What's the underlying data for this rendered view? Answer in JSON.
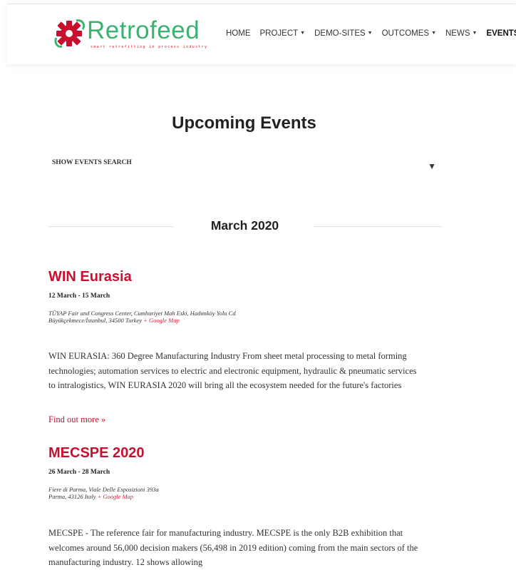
{
  "brand": {
    "name": "Retrofeed",
    "tagline": "smart retrofitting in process industry",
    "logo_color": "#3bb26f",
    "accent": "#c8102e"
  },
  "nav": [
    {
      "label": "HOME",
      "dropdown": false,
      "active": false
    },
    {
      "label": "PROJECT",
      "dropdown": true,
      "active": false
    },
    {
      "label": "DEMO-SITES",
      "dropdown": true,
      "active": false
    },
    {
      "label": "OUTCOMES",
      "dropdown": true,
      "active": false
    },
    {
      "label": "NEWS",
      "dropdown": true,
      "active": false
    },
    {
      "label": "EVENTS",
      "dropdown": false,
      "active": true
    }
  ],
  "page": {
    "title": "Upcoming Events",
    "search_toggle": "SHOW EVENTS SEARCH",
    "month": "March 2020"
  },
  "events": [
    {
      "title": "WIN Eurasia",
      "date": "12 March - 15 March",
      "venue_line1": "TÜYAP Fair and Congress Center, Cumhuriyet Mah Eski, Hadımköy Yolu Cd",
      "venue_line2": "Büyükçekmece/İstanbul, 34500 Turkey",
      "map_link": "+ Google Map",
      "description": "WIN EURASIA: 360 Degree Manufacturing Industry From sheet metal processing to metal forming technologies; automation services to electric and electronic equipment, hydraulic & pneumatic services to intralogistics, WIN EURASIA 2020 will bring all the ecosystem needed for the future's factories",
      "more": "Find out more »"
    },
    {
      "title": "MECSPE 2020",
      "date": "26 March - 28 March",
      "venue_line1": "Fiere di Parma, Viale Delle Esposizioni 393a",
      "venue_line2": "Parma, 43126 Italy",
      "map_link": "+ Google Map",
      "description": "MECSPE - The reference fair for manufacturing industry. MECSPE is the only B2B exhibition that welcomes around 56,000 decision makers (56,498 in 2019 edition) coming from the main sectors of the manufacturing industry. 12 shows allowing"
    }
  ]
}
